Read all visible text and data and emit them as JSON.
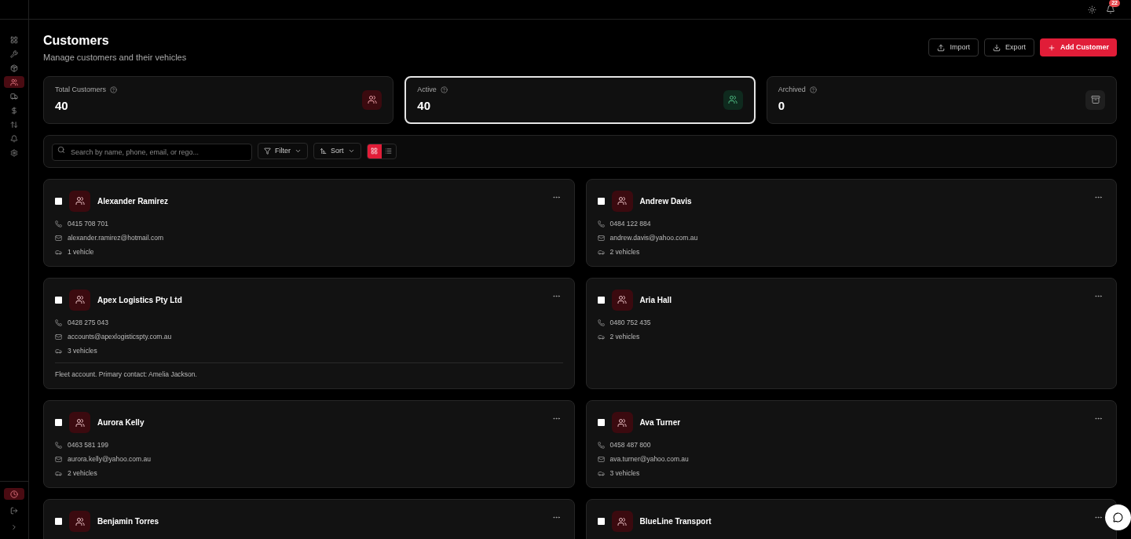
{
  "sidebar": {
    "items": [
      {
        "selected": false
      },
      {
        "selected": false
      },
      {
        "selected": false
      },
      {
        "selected": true
      },
      {
        "selected": false
      },
      {
        "selected": false
      },
      {
        "selected": false
      },
      {
        "selected": false
      },
      {
        "selected": false
      }
    ],
    "bottom": [
      {
        "selected": true
      },
      {
        "selected": false
      },
      {
        "selected": false
      }
    ]
  },
  "topbar": {
    "notification_count": "22"
  },
  "header": {
    "title": "Customers",
    "subtitle": "Manage customers and their vehicles",
    "buttons": [
      {
        "label": "Import",
        "kind": "import"
      },
      {
        "label": "Export",
        "kind": "export"
      },
      {
        "label": "Add Customer",
        "kind": "add"
      }
    ]
  },
  "stats": [
    {
      "label": "Total Customers",
      "value": "40",
      "kind": "total",
      "selected": false
    },
    {
      "label": "Active",
      "value": "40",
      "kind": "active",
      "selected": true
    },
    {
      "label": "Archived",
      "value": "0",
      "kind": "archived",
      "selected": false
    }
  ],
  "toolbar": {
    "search_placeholder": "Search by name, phone, email, or rego...",
    "filter": "Filter",
    "sort": "Sort",
    "views": [
      {
        "kind": "grid",
        "selected": true
      },
      {
        "kind": "list",
        "selected": false
      }
    ]
  },
  "customers": [
    {
      "name": "Alexander Ramirez",
      "checked": false,
      "details": [
        {
          "kind": "phone",
          "text": "0415 708 701"
        },
        {
          "kind": "email",
          "text": "alexander.ramirez@hotmail.com"
        },
        {
          "kind": "vehicles",
          "text": "1 vehicle"
        }
      ]
    },
    {
      "name": "Andrew Davis",
      "checked": false,
      "details": [
        {
          "kind": "phone",
          "text": "0484 122 884"
        },
        {
          "kind": "email",
          "text": "andrew.davis@yahoo.com.au"
        },
        {
          "kind": "vehicles",
          "text": "2 vehicles"
        }
      ]
    },
    {
      "name": "Apex Logistics Pty Ltd",
      "checked": false,
      "details": [
        {
          "kind": "phone",
          "text": "0428 275 043"
        },
        {
          "kind": "email",
          "text": "accounts@apexlogisticspty.com.au"
        },
        {
          "kind": "vehicles",
          "text": "3 vehicles"
        }
      ],
      "note": "Fleet account. Primary contact: Amelia Jackson."
    },
    {
      "name": "Aria Hall",
      "checked": false,
      "details": [
        {
          "kind": "phone",
          "text": "0480 752 435"
        },
        {
          "kind": "vehicles",
          "text": "2 vehicles"
        }
      ]
    },
    {
      "name": "Aurora Kelly",
      "checked": false,
      "details": [
        {
          "kind": "phone",
          "text": "0463 581 199"
        },
        {
          "kind": "email",
          "text": "aurora.kelly@yahoo.com.au"
        },
        {
          "kind": "vehicles",
          "text": "2 vehicles"
        }
      ]
    },
    {
      "name": "Ava Turner",
      "checked": false,
      "details": [
        {
          "kind": "phone",
          "text": "0458 487 800"
        },
        {
          "kind": "email",
          "text": "ava.turner@yahoo.com.au"
        },
        {
          "kind": "vehicles",
          "text": "3 vehicles"
        }
      ]
    },
    {
      "name": "Benjamin Torres",
      "checked": false
    },
    {
      "name": "BlueLine Transport",
      "checked": false
    }
  ]
}
